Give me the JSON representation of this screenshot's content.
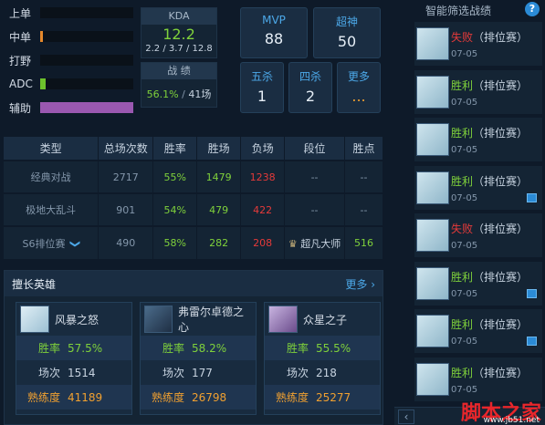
{
  "roles": [
    {
      "label": "上单",
      "fill": 0.0,
      "color": "#e5882b"
    },
    {
      "label": "中单",
      "fill": 0.03,
      "color": "#e5882b"
    },
    {
      "label": "打野",
      "fill": 0.0,
      "color": "#e5882b"
    },
    {
      "label": "ADC",
      "fill": 0.06,
      "color": "#6dc22c"
    },
    {
      "label": "辅助",
      "fill": 1.0,
      "color": "#9a58b0"
    }
  ],
  "kda": {
    "head": "KDA",
    "value": "12.2",
    "detail": "2.2 / 3.7 / 12.8"
  },
  "record": {
    "head": "战 绩",
    "rate": "56.1%",
    "games": "41场"
  },
  "stats": {
    "mvp": {
      "title": "MVP",
      "value": "88"
    },
    "legendary": {
      "title": "超神",
      "value": "50"
    },
    "penta": {
      "title": "五杀",
      "value": "1"
    },
    "quadra": {
      "title": "四杀",
      "value": "2"
    },
    "more": {
      "title": "更多",
      "value": "..."
    }
  },
  "table": {
    "headers": [
      "类型",
      "总场次数",
      "胜率",
      "胜场",
      "负场",
      "段位",
      "胜点"
    ],
    "rows": [
      {
        "type": "经典对战",
        "total": "2717",
        "rate": "55%",
        "wins": "1479",
        "losses": "1238",
        "tier": "--",
        "points": "--"
      },
      {
        "type": "极地大乱斗",
        "total": "901",
        "rate": "54%",
        "wins": "479",
        "losses": "422",
        "tier": "--",
        "points": "--"
      },
      {
        "type": "S6排位赛",
        "total": "490",
        "rate": "58%",
        "wins": "282",
        "losses": "208",
        "tier": "超凡大师",
        "points": "516"
      }
    ]
  },
  "heroes": {
    "title": "擅长英雄",
    "more": "更多",
    "labels": {
      "rate": "胜率",
      "games": "场次",
      "mastery": "熟练度"
    },
    "cards": [
      {
        "name": "风暴之怒",
        "rate": "57.5%",
        "games": "1514",
        "mastery": "41189"
      },
      {
        "name": "弗雷尔卓德之心",
        "rate": "58.2%",
        "games": "177",
        "mastery": "26798"
      },
      {
        "name": "众星之子",
        "rate": "55.5%",
        "games": "218",
        "mastery": "25277"
      }
    ]
  },
  "matches": {
    "title": "智能筛选战绩",
    "help": "?",
    "items": [
      {
        "result": "失败",
        "mode": "（排位赛）",
        "date": "07-05",
        "win": false,
        "icon": false
      },
      {
        "result": "胜利",
        "mode": "（排位赛）",
        "date": "07-05",
        "win": true,
        "icon": false
      },
      {
        "result": "胜利",
        "mode": "（排位赛）",
        "date": "07-05",
        "win": true,
        "icon": false
      },
      {
        "result": "胜利",
        "mode": "（排位赛）",
        "date": "07-05",
        "win": true,
        "icon": true
      },
      {
        "result": "失败",
        "mode": "（排位赛）",
        "date": "07-05",
        "win": false,
        "icon": false
      },
      {
        "result": "胜利",
        "mode": "（排位赛）",
        "date": "07-05",
        "win": true,
        "icon": true
      },
      {
        "result": "胜利",
        "mode": "（排位赛）",
        "date": "07-05",
        "win": true,
        "icon": true
      },
      {
        "result": "胜利",
        "mode": "（排位赛）",
        "date": "07-05",
        "win": true,
        "icon": false
      }
    ]
  },
  "watermark": {
    "main": "脚本之家",
    "sub": "www.jb51.net"
  }
}
